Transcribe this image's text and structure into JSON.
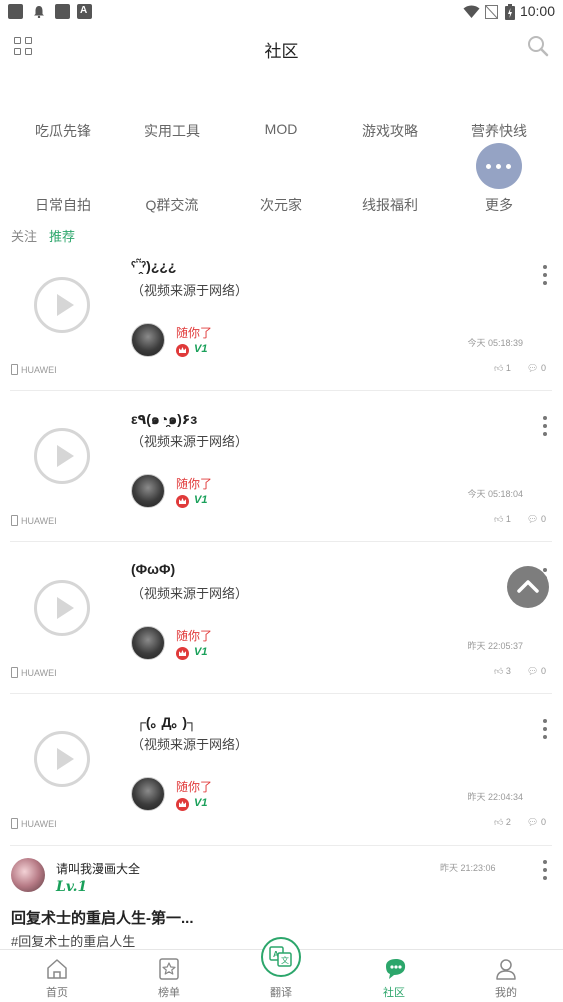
{
  "status_bar": {
    "time": "10:00"
  },
  "header": {
    "title": "社区",
    "menu_icon": "grid-icon",
    "search_icon": "search-icon"
  },
  "categories": {
    "row1": [
      "吃瓜先锋",
      "实用工具",
      "MOD",
      "游戏攻略",
      "营养快线"
    ],
    "row2": [
      "日常自拍",
      "Q群交流",
      "次元家",
      "线报福利",
      "更多"
    ]
  },
  "tabs": [
    {
      "label": "关注",
      "active": false
    },
    {
      "label": "推荐",
      "active": true
    }
  ],
  "posts": [
    {
      "title": "ˁ῁̭ˀ)¿¿¿",
      "subtitle": "（视频来源于网络）",
      "user": "随你了",
      "level_badge": "V1",
      "time": "今天 05:18:39",
      "device": "HUAWEI",
      "likes": "1",
      "comments": "0"
    },
    {
      "title": "ε٩(๑◔̯๑)۶з",
      "subtitle": "（视频来源于网络）",
      "user": "随你了",
      "level_badge": "V1",
      "time": "今天 05:18:04",
      "device": "HUAWEI",
      "likes": "1",
      "comments": "0"
    },
    {
      "title": "(ΦωΦ)",
      "subtitle": "（视频来源于网络）",
      "user": "随你了",
      "level_badge": "V1",
      "time": "昨天 22:05:37",
      "device": "HUAWEI",
      "likes": "3",
      "comments": "0"
    },
    {
      "title": "┌(｡ Д｡ )┐",
      "subtitle": "（视频来源于网络）",
      "user": "随你了",
      "level_badge": "V1",
      "time": "昨天 22:04:34",
      "device": "HUAWEI",
      "likes": "2",
      "comments": "0"
    }
  ],
  "last_post": {
    "user": "请叫我漫画大全",
    "level": "Lv.1",
    "time": "昨天 21:23:06",
    "title": "回复术士的重启人生-第一...",
    "tag": "#回复术士的重启人生"
  },
  "bottom_nav": [
    {
      "label": "首页",
      "icon": "home-icon",
      "active": false
    },
    {
      "label": "榜单",
      "icon": "star-list-icon",
      "active": false
    },
    {
      "label": "翻译",
      "icon": "translate-icon",
      "active": false
    },
    {
      "label": "社区",
      "icon": "community-icon",
      "active": true
    },
    {
      "label": "我的",
      "icon": "profile-icon",
      "active": false
    }
  ],
  "colors": {
    "accent": "#2ca66b",
    "username_red": "#e03a3a",
    "more_bubble": "#95a3c4"
  }
}
